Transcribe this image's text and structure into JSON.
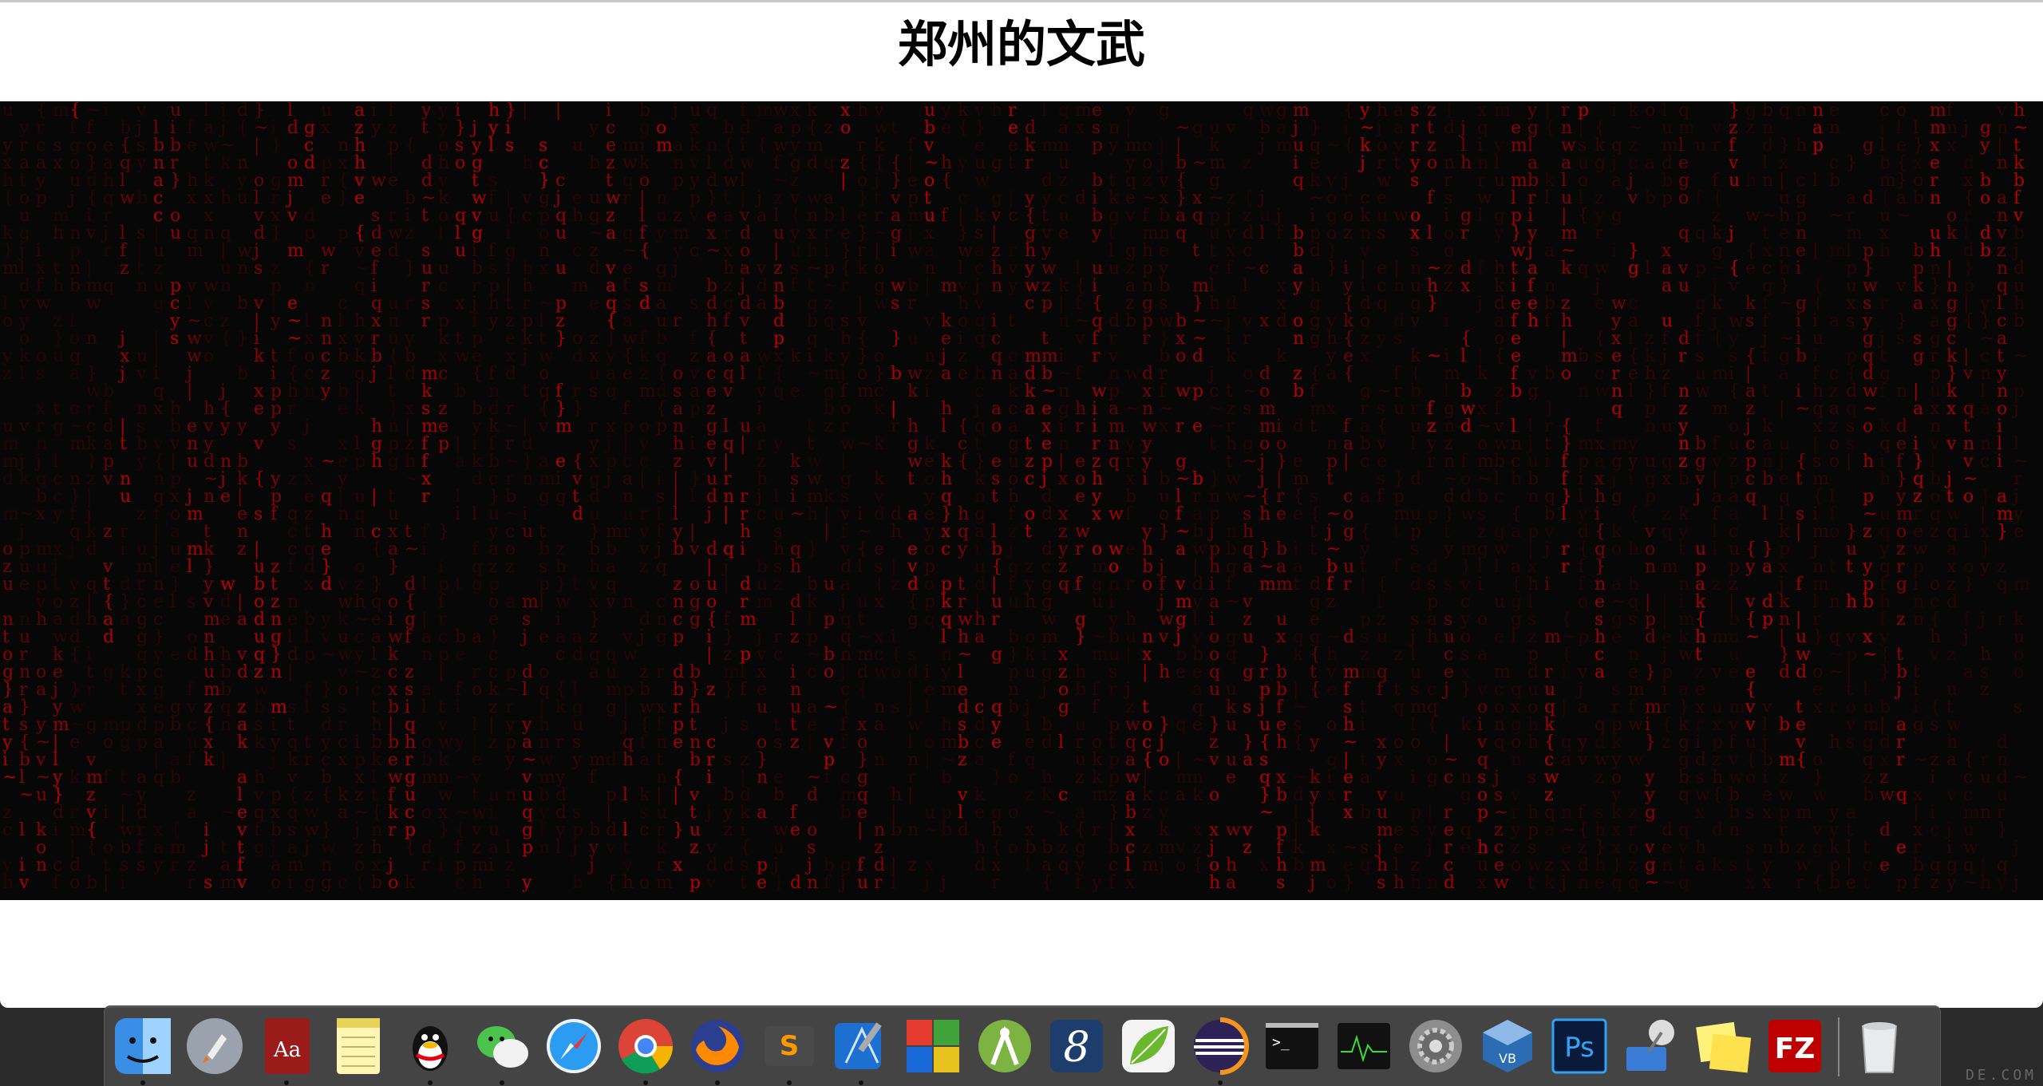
{
  "window": {
    "title": "郑州的文武"
  },
  "matrix": {
    "glyphs": "abcdefghijklmnopqrstuvwxyz{}|~",
    "color": "#c00000"
  },
  "dock": {
    "items": [
      {
        "name": "finder-icon",
        "label": "Finder"
      },
      {
        "name": "launchpad-icon",
        "label": "Launchpad"
      },
      {
        "name": "dictionary-icon",
        "label": "Aa"
      },
      {
        "name": "notes-icon",
        "label": "Notes"
      },
      {
        "name": "qq-icon",
        "label": "QQ"
      },
      {
        "name": "wechat-icon",
        "label": "WeChat"
      },
      {
        "name": "safari-icon",
        "label": "Safari"
      },
      {
        "name": "chrome-icon",
        "label": "Chrome"
      },
      {
        "name": "firefox-icon",
        "label": "Firefox"
      },
      {
        "name": "sublime-text-icon",
        "label": "S"
      },
      {
        "name": "xcode-icon",
        "label": "Xcode"
      },
      {
        "name": "windows-icon",
        "label": "Windows"
      },
      {
        "name": "android-studio-icon",
        "label": "Android Studio"
      },
      {
        "name": "app-8-icon",
        "label": "8"
      },
      {
        "name": "leaf-app-icon",
        "label": "Leaf"
      },
      {
        "name": "eclipse-icon",
        "label": "Eclipse"
      },
      {
        "name": "terminal-icon",
        "label": ">_"
      },
      {
        "name": "activity-monitor-icon",
        "label": "Activity Monitor"
      },
      {
        "name": "system-preferences-icon",
        "label": "System Preferences"
      },
      {
        "name": "virtualbox-icon",
        "label": "VirtualBox"
      },
      {
        "name": "photoshop-icon",
        "label": "Ps"
      },
      {
        "name": "network-utility-icon",
        "label": "Network"
      },
      {
        "name": "stickies-icon",
        "label": "Stickies"
      },
      {
        "name": "filezilla-icon",
        "label": "FZ"
      },
      {
        "name": "trash-icon",
        "label": "Trash"
      }
    ]
  },
  "watermark": "DE.COM"
}
